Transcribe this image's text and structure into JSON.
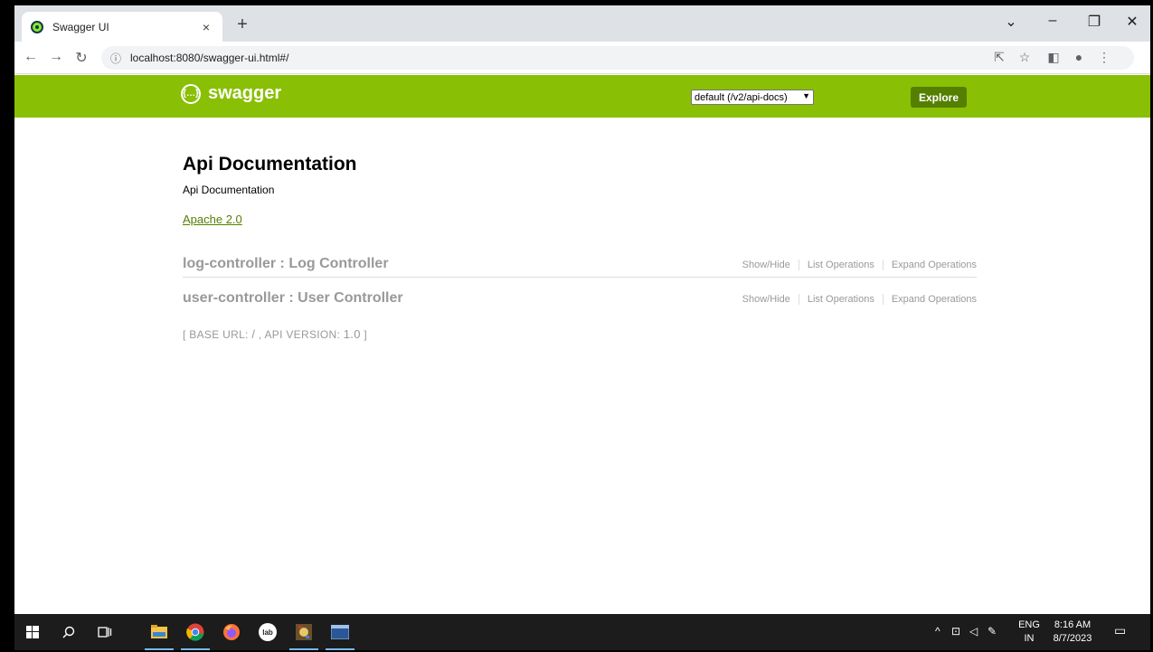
{
  "browser": {
    "tab_title": "Swagger UI",
    "tab_close": "×",
    "new_tab": "+",
    "url": "localhost:8080/swagger-ui.html#/",
    "window_controls": {
      "minimize": "–",
      "restore": "❐",
      "close": "✕",
      "dropdown": "⌄"
    }
  },
  "swagger": {
    "logo_text": "swagger",
    "logo_icon": "{…}",
    "spec_select_value": "default (/v2/api-docs)",
    "explore_label": "Explore",
    "brand_color": "#89bf04"
  },
  "api": {
    "title": "Api Documentation",
    "description": "Api Documentation",
    "license": "Apache 2.0",
    "resources": [
      {
        "name": "log-controller : Log Controller",
        "ops": [
          "Show/Hide",
          "List Operations",
          "Expand Operations"
        ]
      },
      {
        "name": "user-controller : User Controller",
        "ops": [
          "Show/Hide",
          "List Operations",
          "Expand Operations"
        ]
      }
    ],
    "footer": {
      "open": "[ ",
      "base_url_label": "BASE URL",
      "base_url_sep": ": ",
      "base_url": "/",
      "comma": " , ",
      "api_version_label": "API VERSION",
      "api_version_sep": ": ",
      "api_version": "1.0",
      "close": " ]"
    }
  },
  "taskbar": {
    "items": [
      "windows-start-icon",
      "search-icon",
      "task-view-icon",
      "file-explorer-icon",
      "chrome-icon",
      "firefox-icon",
      "lab-icon",
      "app-icon",
      "app-window-icon"
    ],
    "lab_text": "lab",
    "lang_top": "ENG",
    "lang_bottom": "IN",
    "time": "8:16 AM",
    "date": "8/7/2023"
  }
}
